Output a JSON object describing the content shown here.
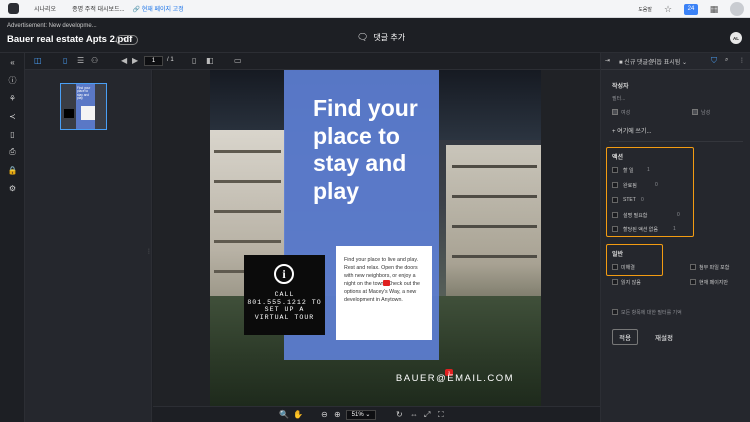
{
  "topbar": {
    "nav": [
      "시나리오",
      "종명 주적 대시보드...",
      "현재 페이지 고정"
    ],
    "lang": "도움말",
    "notification_count": "24"
  },
  "doc": {
    "ad_label": "Advertisement: New developme...",
    "title": "Bauer real estate Apts 2.pdf",
    "version": "v1",
    "add_comment": "댓글 추가",
    "user_initials": "AL"
  },
  "toolbar": {
    "page_current": "1",
    "page_total": "/ 1"
  },
  "thumbnail": {
    "text": "Find your place to stay and play"
  },
  "flyer": {
    "headline": "Find your place to stay and play",
    "cta": "CALL 801.555.1212 TO SET UP A VIRTUAL TOUR",
    "body": "Find your place to live and play. Rest and relax. Open the doors with new neighbors, or enjoy a night on the town. Check out the options at Macey's Way, a new development in Anytown.",
    "marker": "3",
    "email": "BAUER@EMAIL.COM"
  },
  "bottombar": {
    "zoom": "51%"
  },
  "right_panel": {
    "header_sort": "신규 댓글순",
    "header_filter": "거듭 표시됨",
    "author_label": "작성자",
    "author_placeholder": "필터...",
    "author_opt1": "여성",
    "author_opt2": "남성",
    "write_here": "+ 여기에 쓰기...",
    "actions_title": "액션",
    "actions": [
      {
        "label": "할 일",
        "count": "1"
      },
      {
        "label": "완료됨",
        "count": "0"
      },
      {
        "label": "STET",
        "count": "0"
      },
      {
        "label": "설명 필요함",
        "count": "0"
      },
      {
        "label": "할당된 액션 없음",
        "count": "1"
      }
    ],
    "general_title": "일반",
    "general": [
      "미해결",
      "읽지 않음",
      "첨부 파일 포함",
      "현재 페이지만"
    ],
    "option_text": "모든 항목에 대한 필터를 기억",
    "apply": "적용",
    "reset": "재설정"
  }
}
